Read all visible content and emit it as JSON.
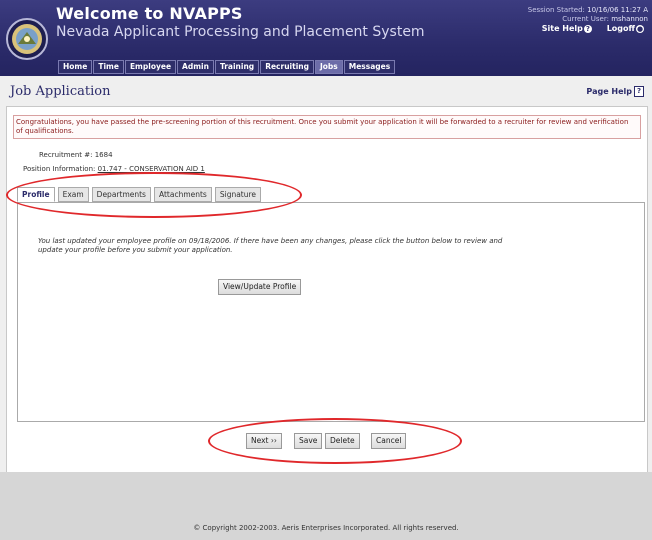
{
  "header": {
    "title": "Welcome to NVAPPS",
    "subtitle": "Nevada Applicant Processing and Placement System",
    "session_label": "Session Started:",
    "session_value": "10/16/06 11:27 A",
    "user_label": "Current User:",
    "user_value": "mshannon",
    "site_help": "Site Help",
    "logoff": "Logoff"
  },
  "nav": {
    "tabs": [
      "Home",
      "Time",
      "Employee",
      "Admin",
      "Training",
      "Recruiting",
      "Jobs",
      "Messages"
    ],
    "active": "Jobs"
  },
  "page": {
    "title": "Job Application",
    "help": "Page Help",
    "help_icon": "?"
  },
  "message": "Congratulations, you have passed the pre-screening portion of this recruitment. Once you submit your application it will be forwarded to a recruiter for review and verification of qualifications.",
  "recruitment": {
    "label": "Recruitment #:",
    "value": "1684",
    "position_label": "Position Information:",
    "position_value": "01.747 - CONSERVATION AID 1"
  },
  "tabs": {
    "items": [
      "Profile",
      "Exam",
      "Departments",
      "Attachments",
      "Signature"
    ],
    "active": "Profile"
  },
  "profile": {
    "text": "You last updated your employee profile on 09/18/2006. If there have been any changes, please click the button below to review and update your profile before you submit your application.",
    "button": "View/Update Profile"
  },
  "actions": {
    "next": "Next ››",
    "save": "Save",
    "delete": "Delete",
    "cancel": "Cancel"
  },
  "footer": {
    "copyright": "© Copyright 2002-2003. Aeris Enterprises Incorporated. All rights reserved."
  }
}
